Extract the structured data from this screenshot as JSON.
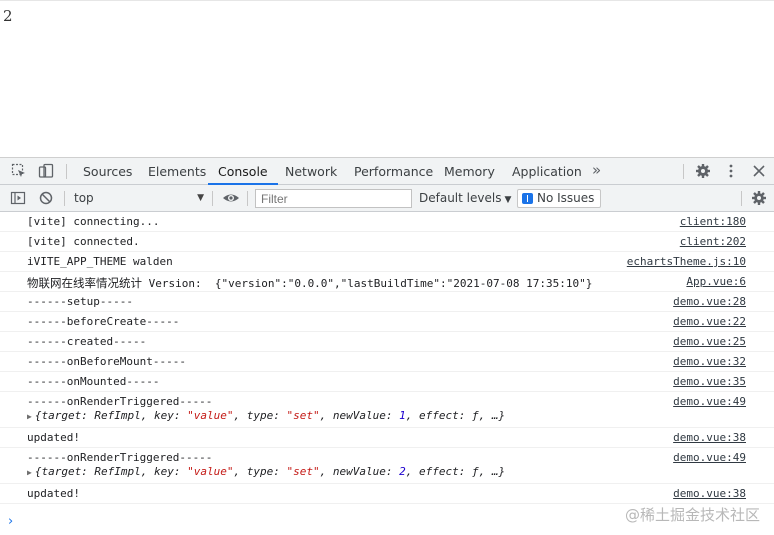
{
  "page": {
    "content": "2"
  },
  "devtools": {
    "tabs": [
      "Sources",
      "Elements",
      "Console",
      "Network",
      "Performance",
      "Memory",
      "Application"
    ],
    "more": "»",
    "toolbar": {
      "context": "top",
      "filter_placeholder": "Filter",
      "levels": "Default levels",
      "issues": "No Issues"
    },
    "messages": [
      {
        "text": "[vite] connecting...",
        "source": "client:180"
      },
      {
        "text": "[vite] connected.",
        "source": "client:202"
      },
      {
        "text": "iVITE_APP_THEME walden",
        "source": "echartsTheme.js:10"
      },
      {
        "text_cjk": "物联网在线率情况统计",
        "text_rest": " Version:  {\"version\":\"0.0.0\",\"lastBuildTime\":\"2021-07-08 17:35:10\"}",
        "source": "App.vue:6"
      },
      {
        "text": "------setup-----",
        "source": "demo.vue:28"
      },
      {
        "text": "------beforeCreate-----",
        "source": "demo.vue:22"
      },
      {
        "text": "------created-----",
        "source": "demo.vue:25"
      },
      {
        "text": "------onBeforeMount-----",
        "source": "demo.vue:32"
      },
      {
        "text": "------onMounted-----",
        "source": "demo.vue:35"
      },
      {
        "text": "------onRenderTriggered-----",
        "source": "demo.vue:49",
        "obj": {
          "a": "{target: RefImpl, key: ",
          "key": "\"value\"",
          "b": ", type: ",
          "type": "\"set\"",
          "c": ", newValue: ",
          "nv": "1",
          "d": ", effect: ƒ, …}"
        }
      },
      {
        "text": "updated!",
        "source": "demo.vue:38"
      },
      {
        "text": "------onRenderTriggered-----",
        "source": "demo.vue:49",
        "obj": {
          "a": "{target: RefImpl, key: ",
          "key": "\"value\"",
          "b": ", type: ",
          "type": "\"set\"",
          "c": ", newValue: ",
          "nv": "2",
          "d": ", effect: ƒ, …}"
        }
      },
      {
        "text": "updated!",
        "source": "demo.vue:38"
      }
    ],
    "prompt": "›"
  },
  "watermark": "@稀土掘金技术社区",
  "icons": [
    "inspect-icon",
    "device-icon",
    "more-tabs-icon",
    "settings-icon",
    "kebab-menu-icon",
    "close-icon",
    "sidebar-toggle-icon",
    "clear-console-icon",
    "eye-icon",
    "issues-icon",
    "console-settings-icon"
  ],
  "colors": {
    "accent": "#1a73e8",
    "string": "#c41a16",
    "number": "#1c00cf"
  }
}
